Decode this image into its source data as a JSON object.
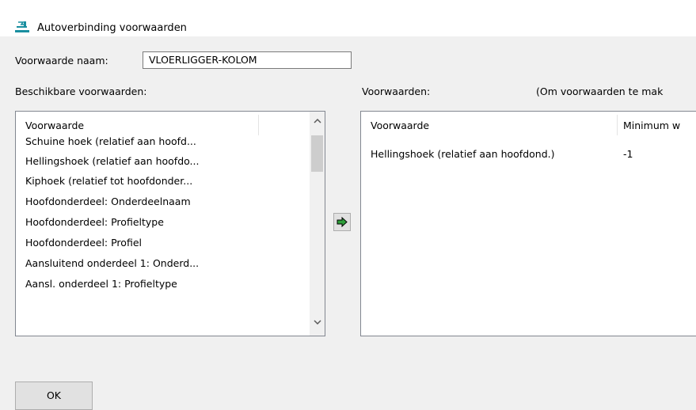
{
  "window": {
    "title": "Autoverbinding voorwaarden"
  },
  "name_field": {
    "label": "Voorwaarde naam:",
    "value": "VLOERLIGGER-KOLOM"
  },
  "available": {
    "label": "Beschikbare voorwaarden:",
    "column_header": "Voorwaarde",
    "items": [
      "Schuine hoek (relatief aan hoofd...",
      "Hellingshoek (relatief aan hoofdo...",
      "Kiphoek (relatief tot hoofdonder...",
      "Hoofdonderdeel: Onderdeelnaam",
      "Hoofdonderdeel: Profieltype",
      "Hoofdonderdeel: Profiel",
      "Aansluitend onderdeel 1: Onderd...",
      "Aansl. onderdeel 1: Profieltype"
    ]
  },
  "conditions": {
    "label": "Voorwaarden:",
    "hint": "(Om voorwaarden te mak",
    "columns": [
      "Voorwaarde",
      "Minimum w"
    ],
    "rows": [
      {
        "condition": "Hellingshoek (relatief aan hoofdond.)",
        "minimum": "-1"
      }
    ]
  },
  "buttons": {
    "ok": "OK"
  },
  "icons": {
    "app": "app-icon",
    "add": "arrow-right-icon",
    "scroll_up": "chevron-up-icon",
    "scroll_down": "chevron-down-icon"
  },
  "colors": {
    "accent_teal": "#1a8fa0",
    "arrow_green": "#2e9e3a"
  }
}
